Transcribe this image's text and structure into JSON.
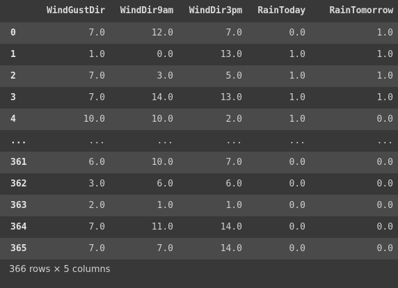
{
  "table": {
    "index_header": "",
    "columns": [
      "WindGustDir",
      "WindDir9am",
      "WindDir3pm",
      "RainToday",
      "RainTomorrow"
    ],
    "rows": [
      {
        "index": "0",
        "values": [
          "7.0",
          "12.0",
          "7.0",
          "0.0",
          "1.0"
        ]
      },
      {
        "index": "1",
        "values": [
          "1.0",
          "0.0",
          "13.0",
          "1.0",
          "1.0"
        ]
      },
      {
        "index": "2",
        "values": [
          "7.0",
          "3.0",
          "5.0",
          "1.0",
          "1.0"
        ]
      },
      {
        "index": "3",
        "values": [
          "7.0",
          "14.0",
          "13.0",
          "1.0",
          "1.0"
        ]
      },
      {
        "index": "4",
        "values": [
          "10.0",
          "10.0",
          "2.0",
          "1.0",
          "0.0"
        ]
      },
      {
        "index": "...",
        "values": [
          "...",
          "...",
          "...",
          "...",
          "..."
        ]
      },
      {
        "index": "361",
        "values": [
          "6.0",
          "10.0",
          "7.0",
          "0.0",
          "0.0"
        ]
      },
      {
        "index": "362",
        "values": [
          "3.0",
          "6.0",
          "6.0",
          "0.0",
          "0.0"
        ]
      },
      {
        "index": "363",
        "values": [
          "2.0",
          "1.0",
          "1.0",
          "0.0",
          "0.0"
        ]
      },
      {
        "index": "364",
        "values": [
          "7.0",
          "11.0",
          "14.0",
          "0.0",
          "0.0"
        ]
      },
      {
        "index": "365",
        "values": [
          "7.0",
          "7.0",
          "14.0",
          "0.0",
          "0.0"
        ]
      }
    ]
  },
  "footer": {
    "shape_text": "366 rows × 5 columns"
  }
}
